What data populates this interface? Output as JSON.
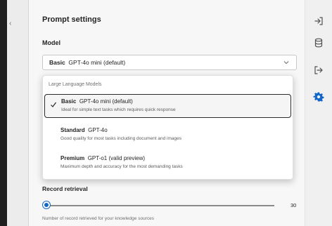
{
  "panel": {
    "title": "Prompt settings",
    "model_label": "Model",
    "select": {
      "tier": "Basic",
      "model_and_note": "GPT-4o mini (default)",
      "chevron_icon": "chevron-down-icon"
    },
    "dropdown": {
      "group_header": "Large Language Models",
      "options": [
        {
          "tier": "Basic",
          "model": "GPT-4o mini (default)",
          "description": "Ideal for simple text tasks which requires quick response",
          "selected": true
        },
        {
          "tier": "Standard",
          "model": "GPT-4o",
          "description": "Good quality for most tasks including document and images",
          "selected": false
        },
        {
          "tier": "Premium",
          "model": "GPT-o1 (valid preview)",
          "description": "Maximum depth and accuracy for the most demanding tasks",
          "selected": false
        }
      ]
    },
    "retrieval": {
      "label": "Record retrieval",
      "value": "30",
      "slider_fraction": 0.0,
      "helper": "Number of record retrieved for your knowledge sources"
    }
  },
  "right_rail": {
    "icons": [
      "sign-in-icon",
      "database-icon",
      "exit-icon",
      "gear-icon"
    ],
    "active_icon": "gear-icon"
  },
  "colors": {
    "accent": "#1266c6",
    "panel_background": "#f7f7f7",
    "dark_background": "#1c1c1c"
  }
}
